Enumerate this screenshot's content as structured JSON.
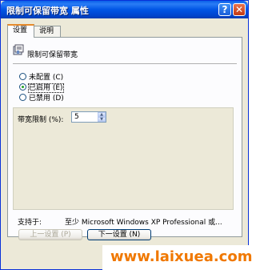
{
  "window": {
    "title": "限制可保留带宽 属性",
    "help_label": "?",
    "close_label": "✕"
  },
  "tabs": [
    {
      "label": "设置"
    },
    {
      "label": "说明"
    }
  ],
  "policy": {
    "name": "限制可保留带宽",
    "icon": "policy-icon"
  },
  "radios": [
    {
      "label": "未配置 (C)",
      "checked": false
    },
    {
      "label": "已启用 (E)",
      "checked": true
    },
    {
      "label": "已禁用 (D)",
      "checked": false
    }
  ],
  "options": {
    "bandwidth_label": "带宽限制 (%):",
    "bandwidth_value": "5"
  },
  "supported": {
    "label": "支持于:",
    "value": "至少 Microsoft Windows XP Professional 或..."
  },
  "buttons": {
    "prev_label": "上一设置 (P)",
    "next_label": "下一设置 (N)"
  },
  "watermark": {
    "text": "www.laixuea.com",
    "color": "#f07800"
  },
  "colors": {
    "titlebar": "#0055e5",
    "dialog_bg": "#ece9d8",
    "tab_accent": "#e68b2c"
  }
}
